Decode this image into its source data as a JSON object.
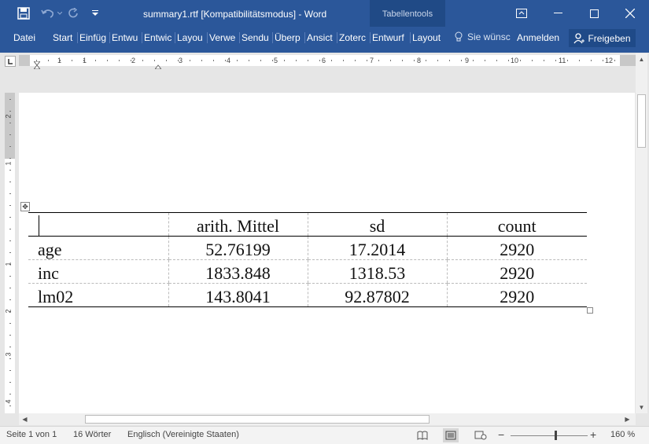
{
  "titlebar": {
    "doc_title": "summary1.rtf [Kompatibilitätsmodus] - Word",
    "context_tab_group": "Tabellentools",
    "icons": [
      "save-icon",
      "undo-icon",
      "redo-icon",
      "customize-qat-icon",
      "ribbon-display-options-icon",
      "minimize-icon",
      "maximize-icon",
      "close-icon"
    ]
  },
  "ribbon": {
    "tabs": [
      "Datei",
      "Start",
      "Einfüg",
      "Entwu",
      "Entwic",
      "Layou",
      "Verwe",
      "Sendu",
      "Überp",
      "Ansict",
      "Zoterc",
      "Entwurf",
      "Layout"
    ],
    "tell_me": "Sie wünsc",
    "sign_in": "Anmelden",
    "share": "Freigeben"
  },
  "ruler": {
    "h_numbers": [
      "1",
      "1",
      "2",
      "3",
      "4",
      "5",
      "6",
      "7",
      "8",
      "9",
      "10",
      "11",
      "12"
    ],
    "v_numbers": [
      "2",
      "1",
      "1",
      "2",
      "3",
      "4"
    ]
  },
  "table": {
    "header": [
      "",
      "arith. Mittel",
      "sd",
      "count"
    ],
    "rows": [
      [
        "age",
        "52.76199",
        "17.2014",
        "2920"
      ],
      [
        "inc",
        "1833.848",
        "1318.53",
        "2920"
      ],
      [
        "lm02",
        "143.8041",
        "92.87802",
        "2920"
      ]
    ]
  },
  "statusbar": {
    "page": "Seite 1 von 1",
    "words": "16 Wörter",
    "language": "Englisch (Vereinigte Staaten)",
    "zoom_minus": "−",
    "zoom_plus": "+",
    "zoom": "160 %",
    "zoom_level_percent": 160
  },
  "colors": {
    "ribbon_blue": "#2b579a",
    "context_tab_bg": "#204a86",
    "page_bg": "#ffffff",
    "workspace_bg": "#e6e6e6"
  }
}
